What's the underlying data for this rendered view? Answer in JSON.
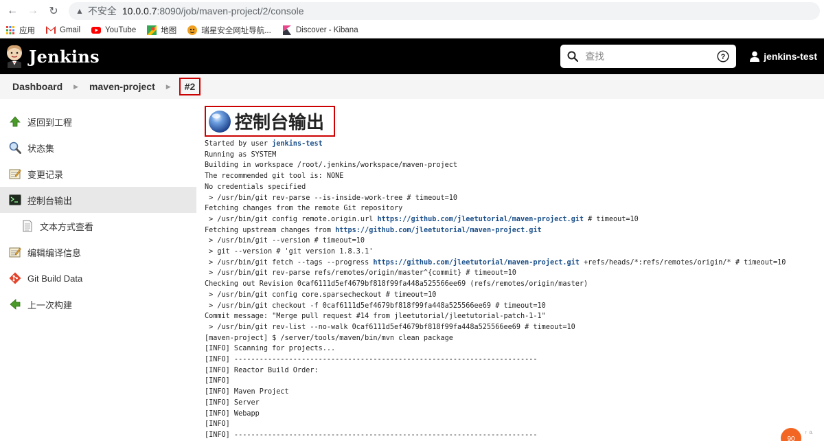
{
  "browser": {
    "insecure_label": "不安全",
    "url_host": "10.0.0.7",
    "url_path": ":8090/job/maven-project/2/console",
    "bookmarks": [
      {
        "label": "应用",
        "icon": "apps-grid-icon"
      },
      {
        "label": "Gmail",
        "icon": "gmail-icon"
      },
      {
        "label": "YouTube",
        "icon": "youtube-icon"
      },
      {
        "label": "地图",
        "icon": "maps-icon"
      },
      {
        "label": "瑞星安全网址导航...",
        "icon": "tiger-icon"
      },
      {
        "label": "Discover - Kibana",
        "icon": "kibana-icon"
      }
    ]
  },
  "header": {
    "brand": "Jenkins",
    "search_placeholder": "查找",
    "user": "jenkins-test"
  },
  "breadcrumb": {
    "dashboard": "Dashboard",
    "project": "maven-project",
    "build": "#2"
  },
  "sidebar": {
    "items": [
      {
        "label": "返回到工程"
      },
      {
        "label": "状态集"
      },
      {
        "label": "变更记录"
      },
      {
        "label": "控制台输出"
      },
      {
        "label": "文本方式查看"
      },
      {
        "label": "编辑编译信息"
      },
      {
        "label": "Git Build Data"
      },
      {
        "label": "上一次构建"
      }
    ]
  },
  "console": {
    "title": "控制台输出",
    "user_link": "jenkins-test",
    "repo_url": "https://github.com/jleetutorial/maven-project.git",
    "lines": {
      "l1": "Started by user ",
      "l2": "Running as SYSTEM",
      "l3": "Building in workspace /root/.jenkins/workspace/maven-project",
      "l4": "The recommended git tool is: NONE",
      "l5": "No credentials specified",
      "l6": " > /usr/bin/git rev-parse --is-inside-work-tree # timeout=10",
      "l7": "Fetching changes from the remote Git repository",
      "l8a": " > /usr/bin/git config remote.origin.url ",
      "l8b": " # timeout=10",
      "l9": "Fetching upstream changes from ",
      "l10": " > /usr/bin/git --version # timeout=10",
      "l11": " > git --version # 'git version 1.8.3.1'",
      "l12a": " > /usr/bin/git fetch --tags --progress ",
      "l12b": " +refs/heads/*:refs/remotes/origin/* # timeout=10",
      "l13": " > /usr/bin/git rev-parse refs/remotes/origin/master^{commit} # timeout=10",
      "l14": "Checking out Revision 0caf6111d5ef4679bf818f99fa448a525566ee69 (refs/remotes/origin/master)",
      "l15": " > /usr/bin/git config core.sparsecheckout # timeout=10",
      "l16": " > /usr/bin/git checkout -f 0caf6111d5ef4679bf818f99fa448a525566ee69 # timeout=10",
      "l17": "Commit message: \"Merge pull request #14 from jleetutorial/jleetutorial-patch-1-1\"",
      "l18": " > /usr/bin/git rev-list --no-walk 0caf6111d5ef4679bf818f99fa448a525566ee69 # timeout=10",
      "l19": "[maven-project] $ /server/tools/maven/bin/mvn clean package",
      "l20": "[INFO] Scanning for projects...",
      "l21": "[INFO] ------------------------------------------------------------------------",
      "l22": "[INFO] Reactor Build Order:",
      "l23": "[INFO]",
      "l24": "[INFO] Maven Project",
      "l25": "[INFO] Server",
      "l26": "[INFO] Webapp",
      "l27": "[INFO]",
      "l28": "[INFO] ------------------------------------------------------------------------"
    }
  },
  "widget": {
    "value": "90"
  }
}
